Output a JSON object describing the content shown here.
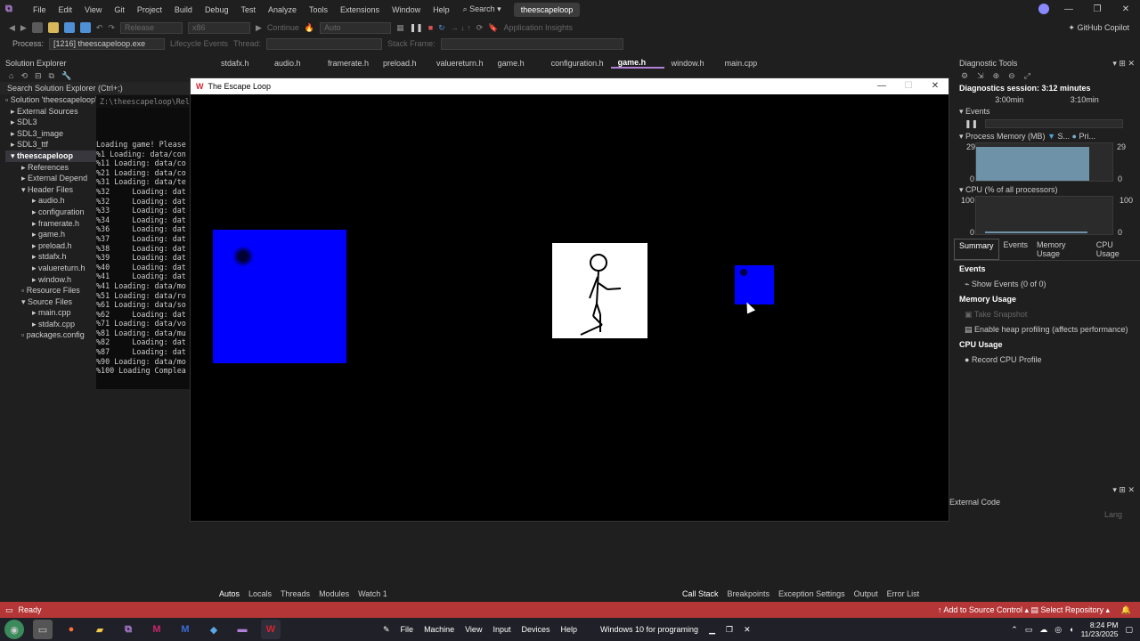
{
  "menu": {
    "items": [
      "File",
      "Edit",
      "View",
      "Git",
      "Project",
      "Build",
      "Debug",
      "Test",
      "Analyze",
      "Tools",
      "Extensions",
      "Window",
      "Help"
    ],
    "search": "Search",
    "solution_name": "theescapeloop"
  },
  "toolbar": {
    "config": "Release",
    "platform": "x86",
    "continue": "Continue",
    "auto": "Auto",
    "app_insights": "Application Insights",
    "copilot": "GitHub Copilot"
  },
  "debug_bar": {
    "process_label": "Process:",
    "process_value": "[1216] theescapeloop.exe",
    "lifecycle": "Lifecycle Events",
    "thread_label": "Thread:",
    "stack_label": "Stack Frame:"
  },
  "solution_explorer": {
    "title": "Solution Explorer",
    "search_placeholder": "Search Solution Explorer (Ctrl+;)",
    "items": [
      "Solution 'theescapeloop'",
      "External Sources",
      "SDL3",
      "SDL3_image",
      "SDL3_ttf",
      "theescapeloop",
      "References",
      "External Depend",
      "Header Files",
      "audio.h",
      "configuration",
      "framerate.h",
      "game.h",
      "preload.h",
      "stdafx.h",
      "valuereturn.h",
      "window.h",
      "Resource Files",
      "Source Files",
      "main.cpp",
      "stdafx.cpp",
      "packages.config"
    ]
  },
  "editor_tabs": [
    "stdafx.h",
    "audio.h",
    "framerate.h",
    "preload.h",
    "valuereturn.h",
    "game.h",
    "configuration.h",
    "game.h",
    "window.h",
    "main.cpp"
  ],
  "console": {
    "path": "Z:\\theescapeloop\\Relea",
    "lines": [
      "Loading game! Please",
      "%1 Loading: data/con",
      "%11 Loading: data/co",
      "%21 Loading: data/co",
      "%31 Loading: data/te",
      "%32     Loading: dat",
      "%32     Loading: dat",
      "%33     Loading: dat",
      "%34     Loading: dat",
      "%36     Loading: dat",
      "%37     Loading: dat",
      "%38     Loading: dat",
      "%39     Loading: dat",
      "%40     Loading: dat",
      "%41     Loading: dat",
      "%41 Loading: data/mo",
      "%51 Loading: data/ro",
      "%61 Loading: data/so",
      "%62     Loading: dat",
      "%71 Loading: data/vo",
      "%81 Loading: data/mu",
      "%82     Loading: dat",
      "%87     Loading: dat",
      "%90 Loading: data/mo",
      "%100 Loading Complea"
    ]
  },
  "game_window": {
    "title": "The Escape Loop",
    "colors": {
      "block": "#0000ff",
      "player_bg": "#ffffff"
    }
  },
  "diagnostic": {
    "title": "Diagnostic Tools",
    "session": "Diagnostics session: 3:12 minutes",
    "time1": "3:00min",
    "time2": "3:10min",
    "events": "Events",
    "process_memory": "Process Memory (MB)",
    "mem_s": "S...",
    "mem_p": "Pri...",
    "mem_max": "29",
    "mem_min": "0",
    "cpu": "CPU (% of all processors)",
    "cpu_max": "100",
    "cpu_min": "0",
    "tabs": [
      "Summary",
      "Events",
      "Memory Usage",
      "CPU Usage"
    ],
    "sec_events": "Events",
    "show_events": "Show Events (0 of 0)",
    "sec_memory": "Memory Usage",
    "take_snapshot": "Take Snapshot",
    "heap_profiling": "Enable heap profiling (affects performance)",
    "sec_cpu": "CPU Usage",
    "record_cpu": "Record CPU Profile",
    "external_code": "External Code",
    "lang": "Lang"
  },
  "bottom_left_tabs": [
    "Autos",
    "Locals",
    "Threads",
    "Modules",
    "Watch 1"
  ],
  "bottom_right_tabs": [
    "Call Stack",
    "Breakpoints",
    "Exception Settings",
    "Output",
    "Error List"
  ],
  "status": {
    "ready": "Ready",
    "source_control": "Add to Source Control",
    "repository": "Select Repository"
  },
  "taskbar": {
    "menu": [
      "File",
      "Machine",
      "View",
      "Input",
      "Devices",
      "Help"
    ],
    "vm_title": "Windows 10 for programing",
    "time": "8:24 PM",
    "date": "11/23/2025"
  }
}
